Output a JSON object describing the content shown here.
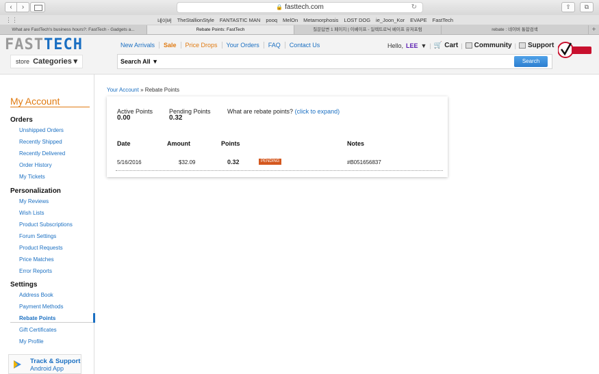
{
  "browser": {
    "url": "fasttech.com",
    "bookmarks": [
      "네이버",
      "TheStallionStyle",
      "FANTASTIC MAN",
      "pooq",
      "MelOn",
      "Metamorphosis",
      "LOST DOG",
      "ie_Joon_Kor",
      "EVAPE",
      "FastTech"
    ],
    "tabs": [
      {
        "label": "What are FastTech's business hours?: FastTech - Gadgets a...",
        "active": false
      },
      {
        "label": "Rebate Points: FastTech",
        "active": true
      },
      {
        "label": "질문답변 1 페이지 | 이베이프 - 일렉트로닉 베이프 유저포럼",
        "active": false
      },
      {
        "label": "rebate : 네이버 통합검색",
        "active": false
      }
    ]
  },
  "header": {
    "logo_part1": "FAST",
    "logo_part2": "TECH",
    "nav": [
      "New Arrivals",
      "Sale",
      "Price Drops",
      "Your Orders",
      "FAQ",
      "Contact Us"
    ],
    "hello": "Hello,",
    "user": "LEE",
    "user_caret": "▼",
    "cart": "Cart",
    "community": "Community",
    "support": "Support",
    "categories_prefix": "store",
    "categories": "Categories",
    "categories_caret": "▾",
    "search_scope": "Search All ▼",
    "search_button": "Search",
    "verisign": "VeriSign Secured"
  },
  "sidebar": {
    "title": "My Account",
    "sections": [
      {
        "title": "Orders",
        "items": [
          "Unshipped Orders",
          "Recently Shipped",
          "Recently Delivered",
          "Order History",
          "My Tickets"
        ]
      },
      {
        "title": "Personalization",
        "items": [
          "My Reviews",
          "Wish Lists",
          "Product Subscriptions",
          "Forum Settings",
          "Product Requests",
          "Price Matches",
          "Error Reports"
        ]
      },
      {
        "title": "Settings",
        "items": [
          "Address Book",
          "Payment Methods",
          "Rebate Points",
          "Gift Certificates",
          "My Profile"
        ]
      }
    ],
    "active_item": "Rebate Points",
    "app_line1": "Track & Support",
    "app_line2": "Android App"
  },
  "main": {
    "breadcrumb_link": "Your Account",
    "breadcrumb_sep": " » ",
    "breadcrumb_current": "Rebate Points",
    "active_points_label": "Active Points",
    "active_points": "0.00",
    "pending_points_label": "Pending Points",
    "pending_points": "0.32",
    "whatare_text": "What are rebate points?",
    "whatare_link": "(click to expand)",
    "columns": [
      "Date",
      "Amount",
      "Points",
      "Notes"
    ],
    "rows": [
      {
        "date": "5/16/2016",
        "amount": "$32.09",
        "points": "0.32",
        "status": "PENDING",
        "notes": "#B051656837"
      }
    ]
  }
}
